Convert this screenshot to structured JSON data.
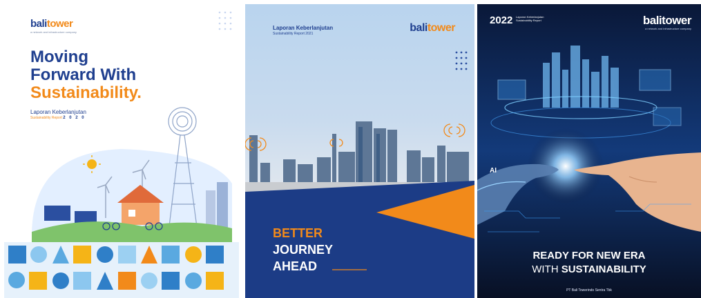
{
  "cover1": {
    "brand_a": "bali",
    "brand_b": "tower",
    "tagline": "a network and infrastructure company",
    "title_line1": "Moving",
    "title_line2": "Forward With",
    "title_line3": "Sustainability.",
    "subtitle": "Laporan Keberlanjutan",
    "subtitle2": "Sustainability Report",
    "year": "2 0 2 0"
  },
  "cover2": {
    "title1": "Laporan Keberlanjutan",
    "title2": "Sustainability Report 2021",
    "brand_a": "bali",
    "brand_b": "tower",
    "headline1": "BETTER",
    "headline2": "JOURNEY",
    "headline3": "AHEAD"
  },
  "cover3": {
    "year": "2022",
    "year_sub": "Laporan Keberlanjutan Sustainability Report",
    "brand_a": "bali",
    "brand_b": "tower",
    "brand_tag": "a network and infrastructure company",
    "ai_label": "AI",
    "headline1": "READY FOR NEW ERA",
    "headline2a": "WITH ",
    "headline2b": "SUSTAINABILITY",
    "company": "PT Bali Towerindo Sentra Tbk"
  },
  "colors": {
    "navy": "#1f3f8f",
    "orange": "#f28a1a",
    "dark": "#0a1330"
  }
}
